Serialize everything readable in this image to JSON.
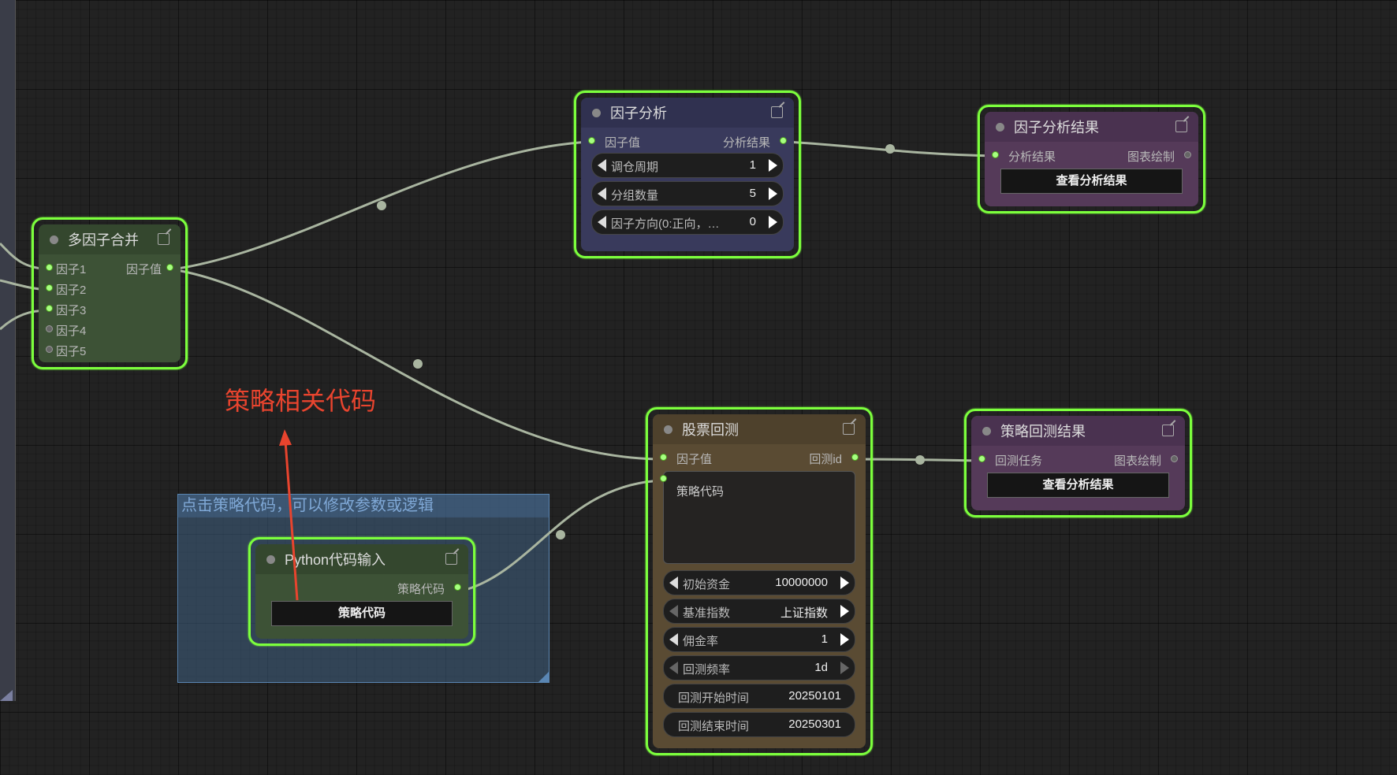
{
  "annotation": {
    "label": "策略相关代码"
  },
  "group": {
    "title": "点击策略代码，可以修改参数或逻辑"
  },
  "nodes": {
    "merge": {
      "title": "多因子合并",
      "inputs": [
        "因子1",
        "因子2",
        "因子3",
        "因子4",
        "因子5"
      ],
      "output": "因子值"
    },
    "analysis": {
      "title": "因子分析",
      "input": "因子值",
      "output": "分析结果",
      "widgets": [
        {
          "label": "调仓周期",
          "value": "1"
        },
        {
          "label": "分组数量",
          "value": "5"
        },
        {
          "label": "因子方向(0:正向，…",
          "value": "0"
        }
      ]
    },
    "analysis_result": {
      "title": "因子分析结果",
      "input": "分析结果",
      "output": "图表绘制",
      "button": "查看分析结果"
    },
    "backtest": {
      "title": "股票回测",
      "input": "因子值",
      "output": "回测id",
      "code_label": "策略代码",
      "widgets": [
        {
          "label": "初始资金",
          "value": "10000000"
        },
        {
          "label": "基准指数",
          "value": "上证指数"
        },
        {
          "label": "佣金率",
          "value": "1"
        },
        {
          "label": "回测频率",
          "value": "1d"
        }
      ],
      "fields": [
        {
          "label": "回测开始时间",
          "value": "20250101"
        },
        {
          "label": "回测结束时间",
          "value": "20250301"
        }
      ]
    },
    "backtest_result": {
      "title": "策略回测结果",
      "input": "回测任务",
      "output": "图表绘制",
      "button": "查看分析结果"
    },
    "python": {
      "title": "Python代码输入",
      "output": "策略代码",
      "button": "策略代码"
    }
  },
  "colors": {
    "selection": "#7cff3d",
    "merge_bg": "#3d5236",
    "analysis_bg": "#393a5c",
    "result_bg": "#553a59",
    "backtest_bg": "#5a4b33",
    "python_bg": "#3d5236",
    "annotation": "#e8442e",
    "wire": "#a9b5a0"
  }
}
